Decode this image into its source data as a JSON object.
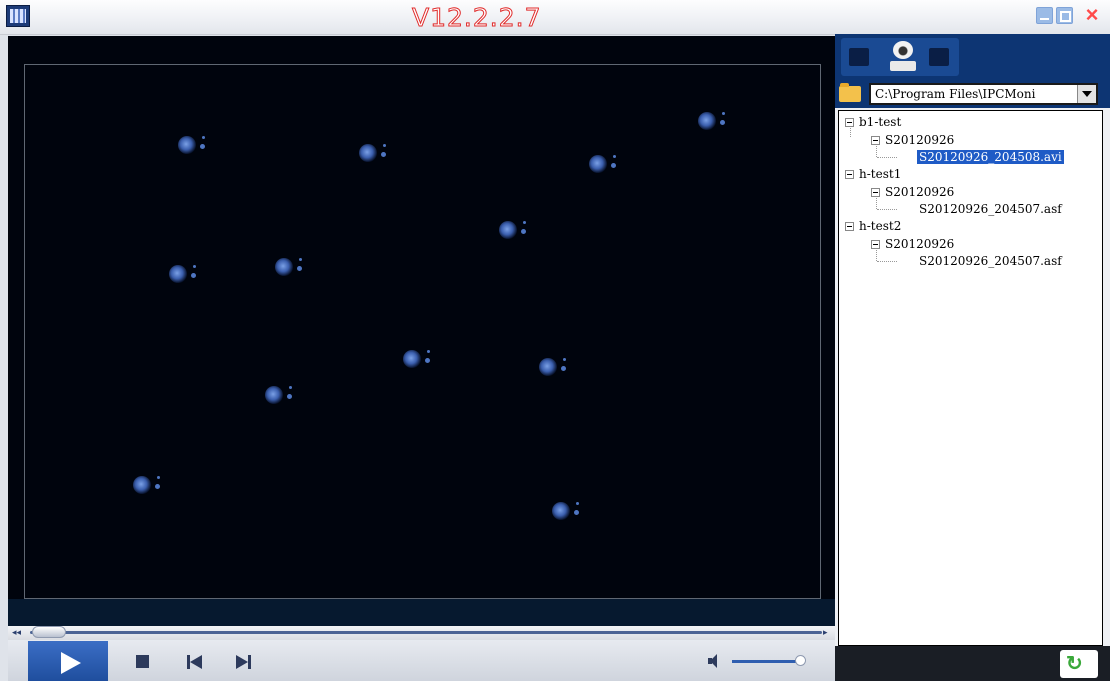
{
  "window": {
    "version": "V12.2.2.7",
    "close_glyph": "×"
  },
  "file_browser": {
    "path": "C:\\Program Files\\IPCMoni",
    "tree": [
      {
        "label": "b1-test"
      },
      {
        "label": "S20120926"
      },
      {
        "label": "S20120926_204508.avi",
        "selected": true
      },
      {
        "label": "h-test1"
      },
      {
        "label": "S20120926"
      },
      {
        "label": "S20120926_204507.asf"
      },
      {
        "label": "h-test2"
      },
      {
        "label": "S20120926"
      },
      {
        "label": "S20120926_204507.asf"
      }
    ]
  },
  "player": {
    "seek_rewind_glyph": "◂◂",
    "seek_end_glyph": "▸",
    "seek_position": 0.0,
    "volume_level": 0.95
  },
  "icons": {
    "refresh": "refresh-icon",
    "refresh_glyph": "↻"
  },
  "colors": {
    "accent": "#1f5bc6",
    "title_version": "#e02a2a",
    "video_bg": "#00040d"
  }
}
